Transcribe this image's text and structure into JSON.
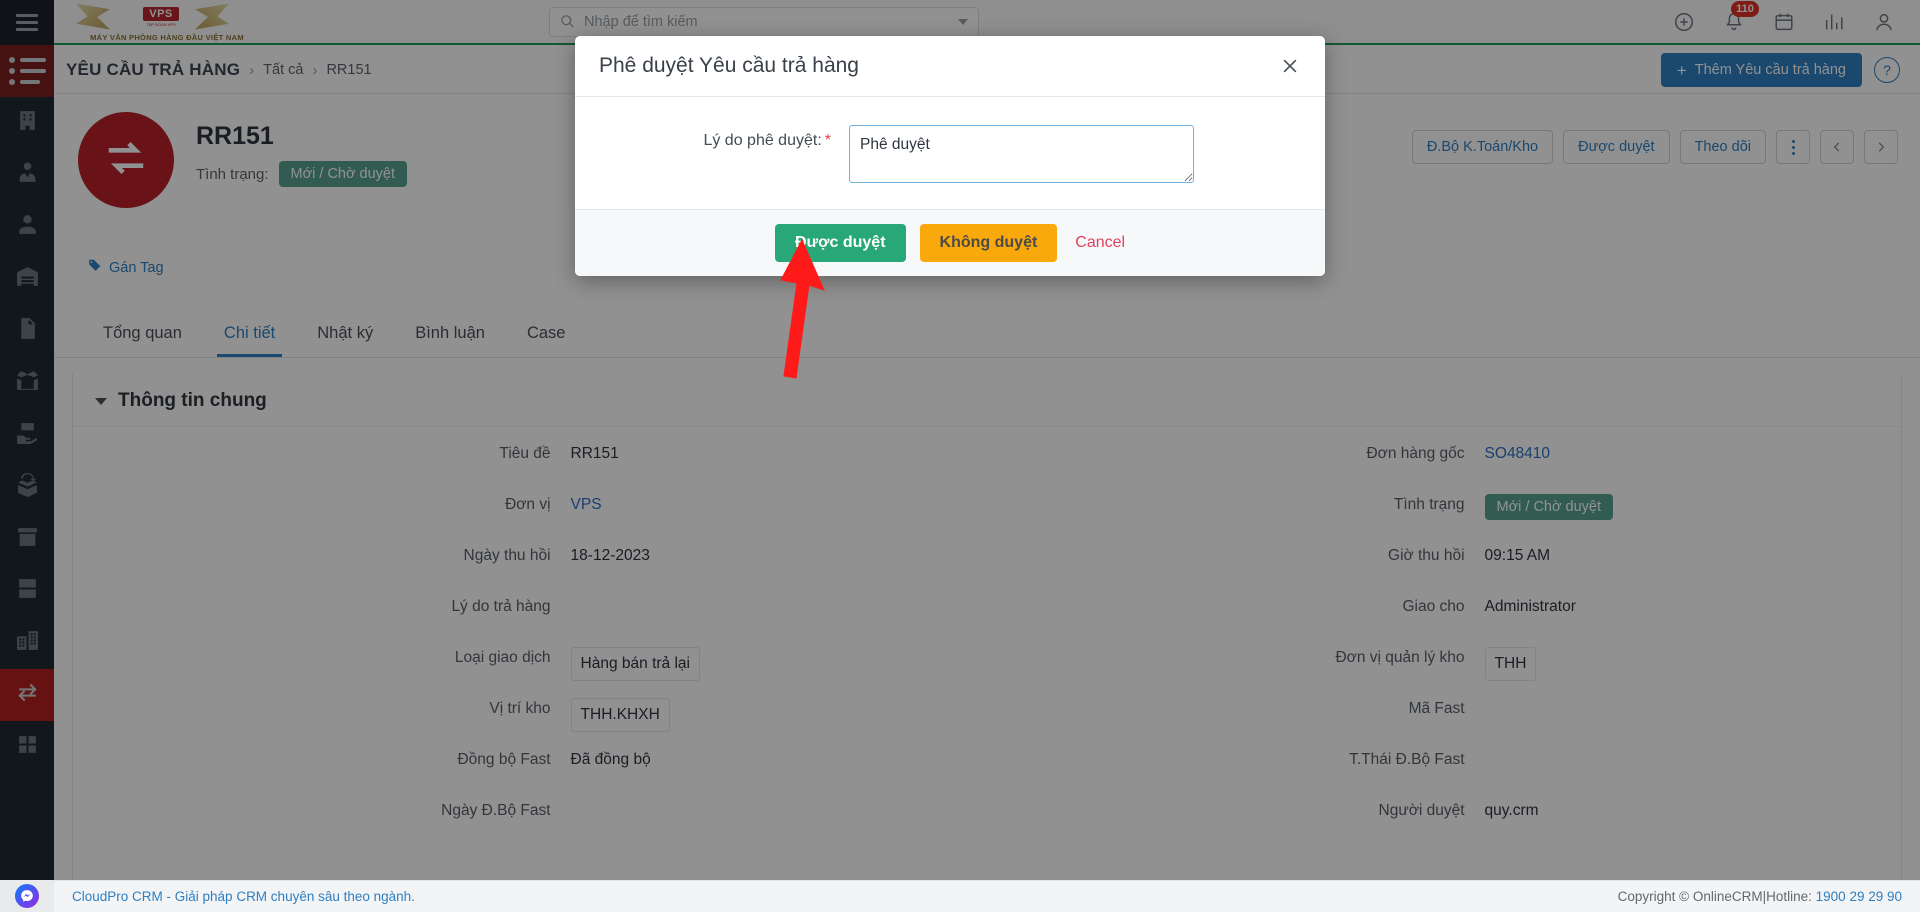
{
  "app": {
    "brand_vps": "VPS",
    "brand_sub": "TẬP ĐOÀN VPS",
    "brand_tagline": "MÁY VĂN PHÒNG HÀNG ĐẦU VIỆT NAM"
  },
  "search": {
    "placeholder": "Nhập để tìm kiếm",
    "value": ""
  },
  "topbar": {
    "notification_count": "110"
  },
  "breadcrumb": {
    "title": "YÊU CẦU TRẢ HÀNG",
    "sep": "›",
    "all": "Tất cả",
    "current": "RR151"
  },
  "page_actions": {
    "add_label": "Thêm Yêu cầu trả hàng",
    "help_label": "?"
  },
  "record": {
    "code": "RR151",
    "status_label": "Tình trạng:",
    "status_value": "Mới / Chờ duyệt",
    "tag_label": "Gán Tag",
    "actions": [
      {
        "label": "Đ.Bộ K.Toán/Kho"
      },
      {
        "label": "Được duyệt"
      },
      {
        "label": "Theo dõi"
      }
    ]
  },
  "tabs": [
    {
      "label": "Tổng quan",
      "active": false
    },
    {
      "label": "Chi tiết",
      "active": true
    },
    {
      "label": "Nhật ký",
      "active": false
    },
    {
      "label": "Bình luận",
      "active": false
    },
    {
      "label": "Case",
      "active": false
    }
  ],
  "section": {
    "title": "Thông tin chung"
  },
  "fields_left": [
    {
      "label": "Tiêu đề",
      "value": "RR151",
      "kind": "text"
    },
    {
      "label": "Đơn vị",
      "value": "VPS",
      "kind": "link"
    },
    {
      "label": "Ngày thu hồi",
      "value": "18-12-2023",
      "kind": "text"
    },
    {
      "label": "Lý do trả hàng",
      "value": "",
      "kind": "text"
    },
    {
      "label": "Loại giao dịch",
      "value": "Hàng bán trả lại",
      "kind": "boxed"
    },
    {
      "label": "Vị trí kho",
      "value": "THH.KHXH",
      "kind": "boxed"
    },
    {
      "label": "Đồng bộ Fast",
      "value": "Đã đồng bộ",
      "kind": "text"
    },
    {
      "label": "Ngày Đ.Bộ Fast",
      "value": "",
      "kind": "text"
    }
  ],
  "fields_right": [
    {
      "label": "Đơn hàng gốc",
      "value": "SO48410",
      "kind": "link"
    },
    {
      "label": "Tình trạng",
      "value": "Mới / Chờ duyệt",
      "kind": "pill"
    },
    {
      "label": "Giờ thu hồi",
      "value": "09:15 AM",
      "kind": "text"
    },
    {
      "label": "Giao cho",
      "value": "Administrator",
      "kind": "text"
    },
    {
      "label": "Đơn vị quản lý kho",
      "value": "THH",
      "kind": "boxed"
    },
    {
      "label": "Mã Fast",
      "value": "",
      "kind": "text"
    },
    {
      "label": "T.Thái Đ.Bộ Fast",
      "value": "",
      "kind": "text"
    },
    {
      "label": "Người duyệt",
      "value": "quy.crm",
      "kind": "text"
    }
  ],
  "modal": {
    "title": "Phê duyệt Yêu cầu trả hàng",
    "reason_label": "Lý do phê duyệt:",
    "required_mark": "*",
    "reason_value": "Phê duyệt",
    "reason_placeholder": "",
    "approve_label": "Được duyệt",
    "reject_label": "Không duyệt",
    "cancel_label": "Cancel"
  },
  "footer": {
    "left": "CloudPro CRM - Giải pháp CRM chuyên sâu theo ngành.",
    "copyright": "Copyright © OnlineCRM",
    "divider": "|",
    "hotline_label": "Hotline:",
    "hotline_number": "1900 29 29 90"
  },
  "sidebar": {
    "items": [
      {
        "name": "menu-list",
        "active": true
      },
      {
        "name": "building"
      },
      {
        "name": "business-person"
      },
      {
        "name": "person"
      },
      {
        "name": "warehouse"
      },
      {
        "name": "document"
      },
      {
        "name": "open-box"
      },
      {
        "name": "box-hand"
      },
      {
        "name": "return-box"
      },
      {
        "name": "archive-box"
      },
      {
        "name": "drawer-cabinet"
      },
      {
        "name": "city-buildings"
      },
      {
        "name": "return-arrows",
        "active2": true
      },
      {
        "name": "grid-apps"
      }
    ]
  },
  "colors": {
    "accent_blue": "#2e7fc1",
    "approve_green": "#28a878",
    "reject_orange": "#f9a90b",
    "cancel_red": "#e0425c",
    "status_teal": "#59a18f",
    "rail_dark": "#212a33",
    "badge_red": "#e0322b",
    "header_green_rule": "#1f9b60"
  }
}
